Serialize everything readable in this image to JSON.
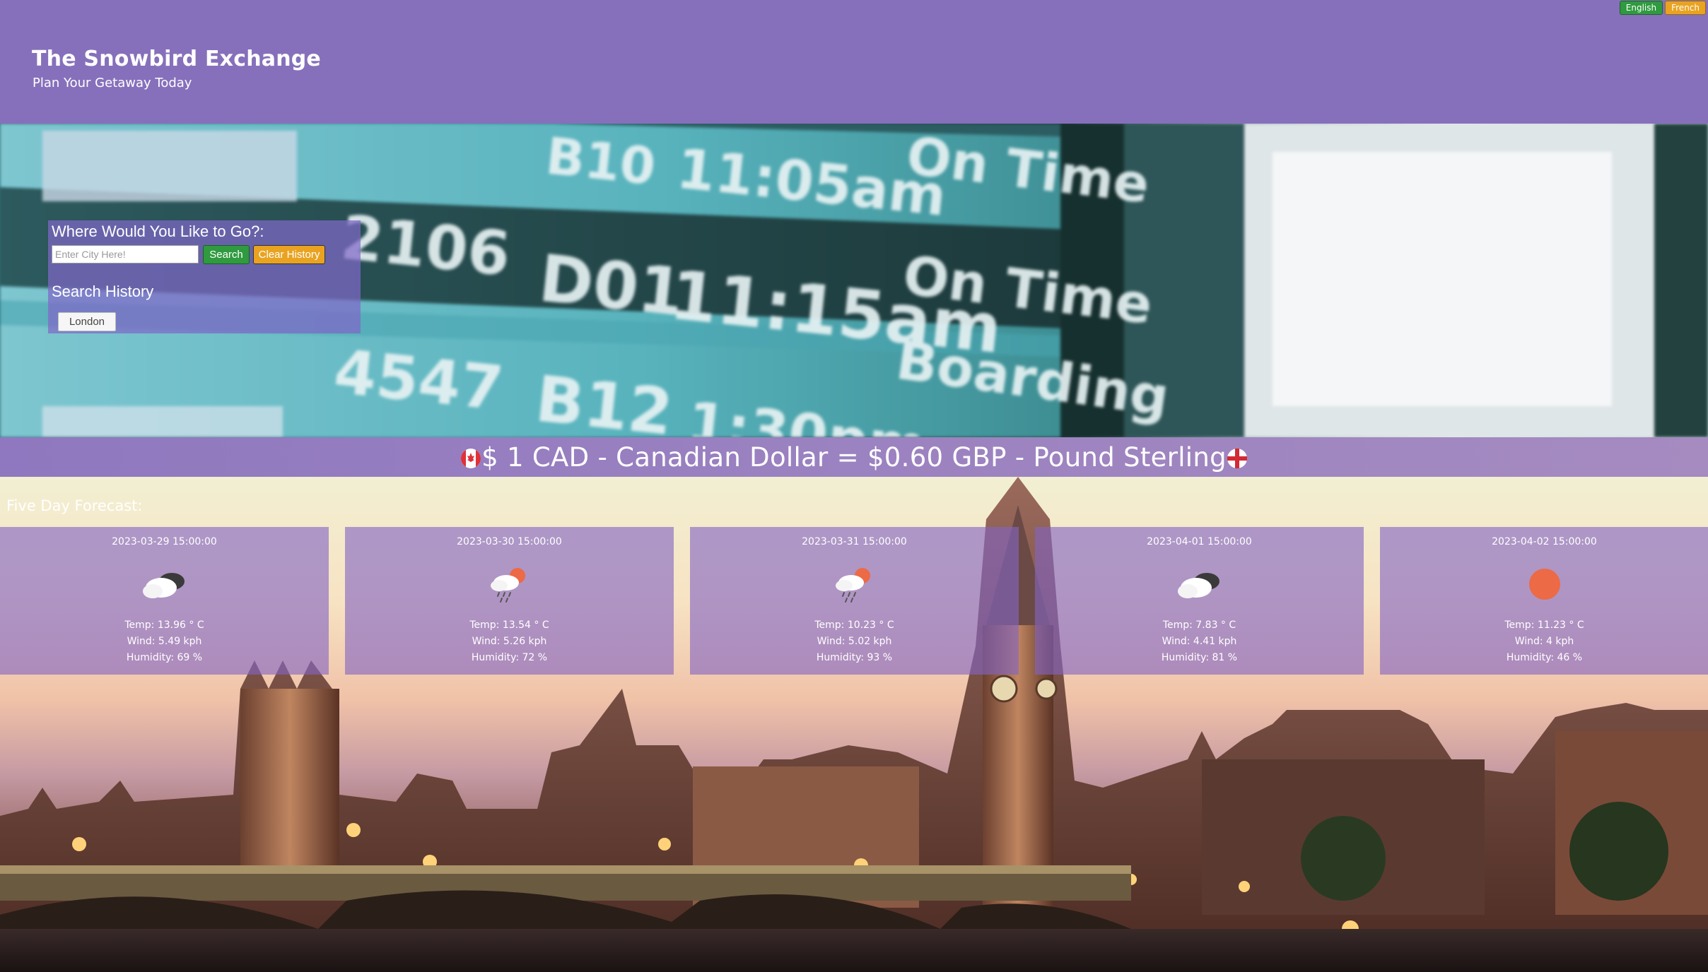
{
  "header": {
    "title": "The Snowbird Exchange",
    "tagline": "Plan Your Getaway Today",
    "languages": [
      "English",
      "French"
    ]
  },
  "search": {
    "heading": "Where Would You Like to Go?:",
    "placeholder": "Enter City Here!",
    "value": "",
    "search_label": "Search",
    "clear_label": "Clear History",
    "history_heading": "Search History",
    "history": [
      "London"
    ]
  },
  "exchange": {
    "text": "$ 1 CAD - Canadian Dollar = $0.60 GBP - Pound Sterling",
    "from_flag_icon": "canada-flag-icon",
    "to_flag_icon": "england-flag-icon"
  },
  "forecast": {
    "heading": "Five Day Forecast:",
    "days": [
      {
        "date": "2023-03-29 15:00:00",
        "icon": "dark-cloud-icon",
        "temp": "Temp: 13.96 ° C",
        "wind": "Wind: 5.49 kph",
        "humidity": "Humidity: 69 %"
      },
      {
        "date": "2023-03-30 15:00:00",
        "icon": "rain-sun-icon",
        "temp": "Temp: 13.54 ° C",
        "wind": "Wind: 5.26 kph",
        "humidity": "Humidity: 72 %"
      },
      {
        "date": "2023-03-31 15:00:00",
        "icon": "rain-sun-icon",
        "temp": "Temp: 10.23 ° C",
        "wind": "Wind: 5.02 kph",
        "humidity": "Humidity: 93 %"
      },
      {
        "date": "2023-04-01 15:00:00",
        "icon": "dark-cloud-icon",
        "temp": "Temp: 7.83 ° C",
        "wind": "Wind: 4.41 kph",
        "humidity": "Humidity: 81 %"
      },
      {
        "date": "2023-04-02 15:00:00",
        "icon": "sun-icon",
        "temp": "Temp: 11.23 ° C",
        "wind": "Wind: 4 kph",
        "humidity": "Humidity: 46 %"
      }
    ]
  },
  "colors": {
    "header_bg": "#8670bb",
    "search_green": "#2f9a3f",
    "clear_amber": "#e9a321",
    "sun_orange": "#ec6a45"
  }
}
